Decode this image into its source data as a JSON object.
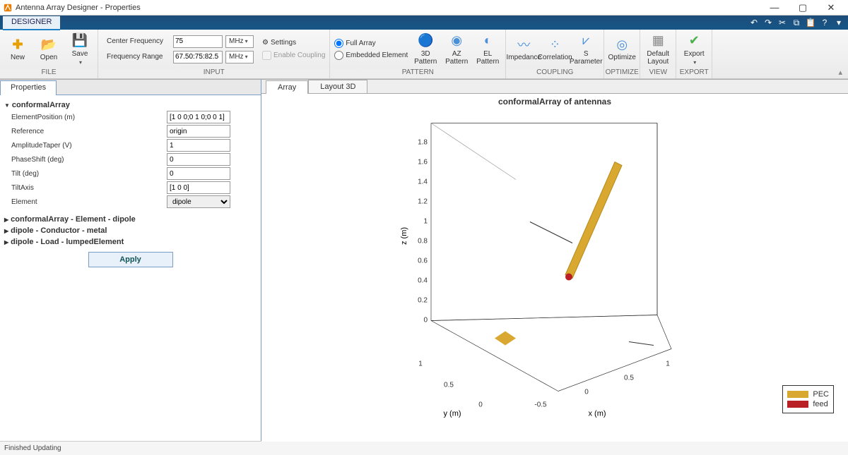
{
  "window": {
    "title": "Antenna Array Designer - Properties"
  },
  "ribbon_tab": "DESIGNER",
  "file_group": {
    "label": "FILE",
    "new": "New",
    "open": "Open",
    "save": "Save"
  },
  "input_group": {
    "label": "INPUT",
    "center_freq_label": "Center Frequency",
    "center_freq_value": "75",
    "center_freq_unit": "MHz",
    "freq_range_label": "Frequency Range",
    "freq_range_value": "67.50:75:82.5",
    "freq_range_unit": "MHz",
    "settings": "Settings",
    "enable_coupling": "Enable Coupling"
  },
  "pattern_group": {
    "label": "PATTERN",
    "full_array": "Full Array",
    "embedded": "Embedded Element",
    "p3d": "3D Pattern",
    "az": "AZ Pattern",
    "el": "EL Pattern"
  },
  "coupling_group": {
    "label": "COUPLING",
    "impedance": "Impedance",
    "correlation": "Correlation",
    "sparam": "S Parameter"
  },
  "optimize_group": {
    "label": "OPTIMIZE",
    "optimize": "Optimize"
  },
  "view_group": {
    "label": "VIEW",
    "default_layout": "Default Layout"
  },
  "export_group": {
    "label": "EXPORT",
    "export": "Export"
  },
  "properties": {
    "tab": "Properties",
    "section_main": "conformalArray",
    "rows": {
      "elempos_label": "ElementPosition (m)",
      "elempos_value": "[1 0 0;0 1 0;0 0 1]",
      "reference_label": "Reference",
      "reference_value": "origin",
      "amptaper_label": "AmplitudeTaper (V)",
      "amptaper_value": "1",
      "phase_label": "PhaseShift (deg)",
      "phase_value": "0",
      "tilt_label": "Tilt (deg)",
      "tilt_value": "0",
      "tiltaxis_label": "TiltAxis",
      "tiltaxis_value": "[1 0 0]",
      "element_label": "Element",
      "element_value": "dipole"
    },
    "section2": "conformalArray - Element - dipole",
    "section3": "dipole - Conductor - metal",
    "section4": "dipole - Load - lumpedElement",
    "apply": "Apply"
  },
  "viz_tabs": {
    "array": "Array",
    "layout3d": "Layout 3D"
  },
  "plot": {
    "title": "conformalArray of antennas",
    "xlabel": "x (m)",
    "ylabel": "y (m)",
    "zlabel": "z (m)",
    "xticks": [
      "-0.5",
      "0",
      "0.5",
      "1"
    ],
    "yticks": [
      "0",
      "0.5",
      "1"
    ],
    "zticks": [
      "0",
      "0.2",
      "0.4",
      "0.6",
      "0.8",
      "1",
      "1.2",
      "1.4",
      "1.6",
      "1.8"
    ],
    "legend_pec": "PEC",
    "legend_feed": "feed",
    "color_pec": "#d9a830",
    "color_feed": "#b92025"
  },
  "status": "Finished Updating",
  "chart_data": {
    "type": "3d-geometry",
    "title": "conformalArray of antennas",
    "axes": {
      "x": {
        "label": "x (m)",
        "range": [
          -0.5,
          1
        ]
      },
      "y": {
        "label": "y (m)",
        "range": [
          0,
          1
        ]
      },
      "z": {
        "label": "z (m)",
        "range": [
          0,
          1.8
        ]
      }
    },
    "elements": [
      {
        "type": "dipole",
        "material": "PEC",
        "position": [
          1,
          0,
          0
        ],
        "orientation": "tilted-z",
        "feed": true
      },
      {
        "type": "bowtie",
        "material": "PEC",
        "position": [
          0,
          1,
          0
        ],
        "orientation": "xy-plane"
      },
      {
        "type": "wire",
        "position": [
          0,
          0,
          1
        ],
        "orientation": "y-axis"
      }
    ],
    "legend": [
      {
        "name": "PEC",
        "color": "#d9a830"
      },
      {
        "name": "feed",
        "color": "#b92025"
      }
    ]
  }
}
